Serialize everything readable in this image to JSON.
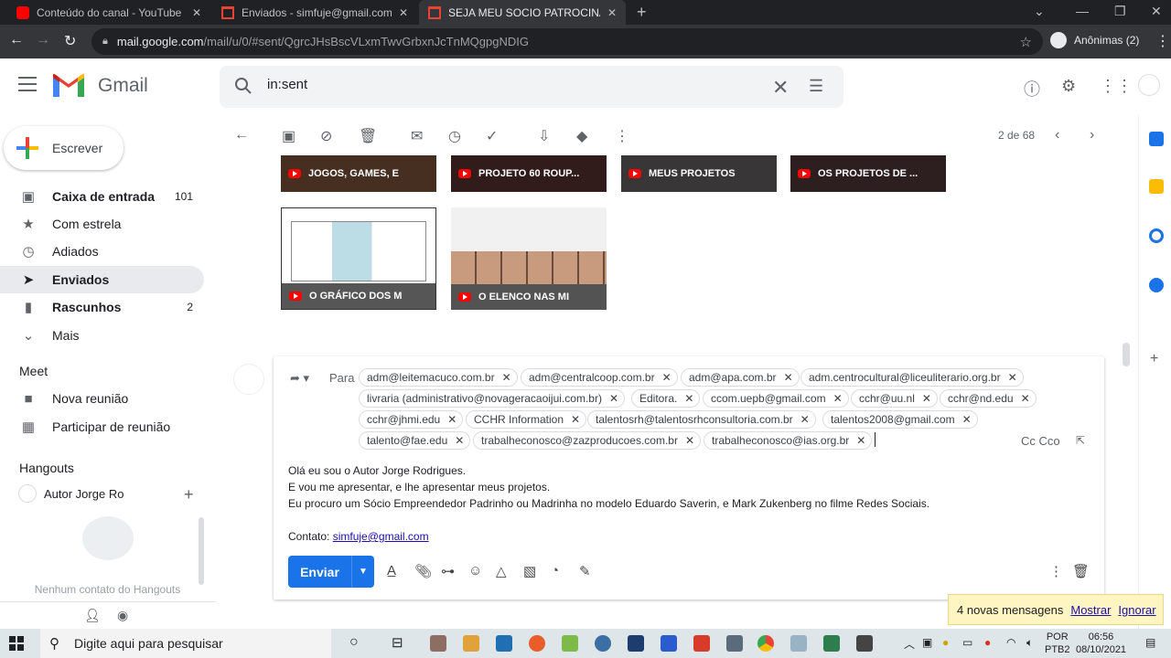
{
  "browser": {
    "tabs": [
      {
        "title": "Conteúdo do canal - YouTube St",
        "favicon_color": "#ff0000"
      },
      {
        "title": "Enviados - simfuje@gmail.com -",
        "favicon_color": "#ea4335"
      },
      {
        "title": "SEJA MEU SOCIO PATROCINADO",
        "favicon_color": "#ea4335",
        "active": true
      }
    ],
    "url_host": "mail.google.com",
    "url_path": "/mail/u/0/#sent/QgrcJHsBscVLxmTwvGrbxnJcTnMQgpgNDIG",
    "profile_label": "Anônimas (2)"
  },
  "gmail": {
    "brand": "Gmail",
    "search_value": "in:sent",
    "compose_label": "Escrever",
    "nav": [
      {
        "label": "Caixa de entrada",
        "count": "101",
        "bold": true,
        "icon": "inbox-icon"
      },
      {
        "label": "Com estrela",
        "count": "",
        "bold": false,
        "icon": "star-icon"
      },
      {
        "label": "Adiados",
        "count": "",
        "bold": false,
        "icon": "clock-icon"
      },
      {
        "label": "Enviados",
        "count": "",
        "bold": true,
        "icon": "send-icon",
        "selected": true
      },
      {
        "label": "Rascunhos",
        "count": "2",
        "bold": true,
        "icon": "draft-icon"
      },
      {
        "label": "Mais",
        "count": "",
        "bold": false,
        "icon": "chevron-down-icon"
      }
    ],
    "meet": {
      "title": "Meet",
      "items": [
        "Nova reunião",
        "Participar de reunião"
      ]
    },
    "hangouts": {
      "title": "Hangouts",
      "user": "Autor Jorge Ro",
      "empty_text": "Nenhum contato do Hangouts"
    },
    "pager": "2 de 68",
    "thumbnails": [
      {
        "caption": "JOGOS, GAMES, E",
        "color": "#c0602c"
      },
      {
        "caption": "PROJETO 60 ROUP...",
        "color": "#6b1414"
      },
      {
        "caption": "MEUS PROJETOS",
        "color": "#8a7f82"
      },
      {
        "caption": "OS PROJETOS DE ...",
        "color": "#5b2424"
      },
      {
        "caption": "O GRÁFICO DOS M",
        "color": "#dfe9ea"
      },
      {
        "caption": "O ELENCO NAS MI",
        "color": "#eceff1"
      }
    ],
    "compose": {
      "to_label": "Para",
      "recipients": [
        "adm@leitemacuco.com.br",
        "adm@centralcoop.com.br",
        "adm@apa.com.br",
        "adm.centrocultural@liceuliterario.org.br",
        "livraria (administrativo@novageracaoijui.com.br)",
        "Editora.",
        "ccom.uepb@gmail.com",
        "cchr@uu.nl",
        "cchr@nd.edu",
        "cchr@jhmi.edu",
        "CCHR Information",
        "talentosrh@talentosrhconsultoria.com.br",
        "talentos2008@gmail.com",
        "talento@fae.edu",
        "trabalheconosco@zazproducoes.com.br",
        "trabalheconosco@ias.org.br"
      ],
      "cc_label": "Cc Cco",
      "body_lines": [
        "Olá eu sou o Autor Jorge Rodrigues.",
        "E vou me apresentar, e lhe apresentar meus projetos.",
        "Eu procuro um Sócio Empreendedor Padrinho ou Madrinha no modelo Eduardo Saverin, e Mark Zukenberg no filme Redes Sociais."
      ],
      "contact_label": "Contato:",
      "contact_email": "simfuje@gmail.com",
      "send_label": "Enviar"
    },
    "notification": {
      "text": "4 novas mensagens",
      "show": "Mostrar",
      "ignore": "Ignorar"
    }
  },
  "taskbar": {
    "search_placeholder": "Digite aqui para pesquisar",
    "lang_top": "POR",
    "lang_bottom": "PTB2",
    "time": "06:56",
    "date": "08/10/2021"
  }
}
